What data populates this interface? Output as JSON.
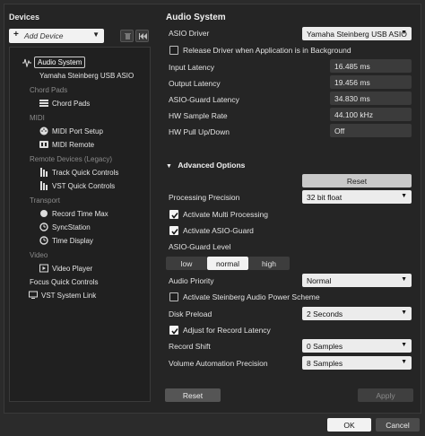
{
  "left": {
    "title": "Devices",
    "add_device": "Add Device",
    "tree": {
      "audio_system": "Audio System",
      "asio_driver_item": "Yamaha Steinberg USB ASIO",
      "cat_chord_pads": "Chord Pads",
      "chord_pads": "Chord Pads",
      "cat_midi": "MIDI",
      "midi_port_setup": "MIDI Port Setup",
      "midi_remote": "MIDI Remote",
      "cat_remote": "Remote Devices (Legacy)",
      "track_quick_controls": "Track Quick Controls",
      "vst_quick_controls": "VST Quick Controls",
      "cat_transport": "Transport",
      "record_time_max": "Record Time Max",
      "syncstation": "SyncStation",
      "time_display": "Time Display",
      "cat_video": "Video",
      "video_player": "Video Player",
      "focus_quick_controls": "Focus Quick Controls",
      "vst_system_link": "VST System Link"
    }
  },
  "right": {
    "title": "Audio System",
    "asio_driver_label": "ASIO Driver",
    "asio_driver_value": "Yamaha Steinberg USB ASIO",
    "release_driver_label": "Release Driver when Application is in Background",
    "release_driver_checked": false,
    "input_latency_label": "Input Latency",
    "input_latency_value": "16.485 ms",
    "output_latency_label": "Output Latency",
    "output_latency_value": "19.456 ms",
    "asio_guard_latency_label": "ASIO-Guard Latency",
    "asio_guard_latency_value": "34.830 ms",
    "hw_sample_rate_label": "HW Sample Rate",
    "hw_sample_rate_value": "44.100 kHz",
    "hw_pull_label": "HW Pull Up/Down",
    "hw_pull_value": "Off",
    "advanced_title": "Advanced Options",
    "reset_inner": "Reset",
    "processing_precision_label": "Processing Precision",
    "processing_precision_value": "32 bit float",
    "activate_multi_label": "Activate Multi Processing",
    "activate_multi_checked": true,
    "activate_asio_guard_label": "Activate ASIO-Guard",
    "activate_asio_guard_checked": true,
    "asio_guard_level_label": "ASIO-Guard Level",
    "level_low": "low",
    "level_normal": "normal",
    "level_high": "high",
    "level_selected": "normal",
    "audio_priority_label": "Audio Priority",
    "audio_priority_value": "Normal",
    "activate_power_label": "Activate Steinberg Audio Power Scheme",
    "activate_power_checked": false,
    "disk_preload_label": "Disk Preload",
    "disk_preload_value": "2 Seconds",
    "adjust_record_label": "Adjust for Record Latency",
    "adjust_record_checked": true,
    "record_shift_label": "Record Shift",
    "record_shift_value": "0 Samples",
    "volume_precision_label": "Volume Automation Precision",
    "volume_precision_value": "8 Samples",
    "reset_button": "Reset",
    "apply_button": "Apply"
  },
  "footer": {
    "ok": "OK",
    "cancel": "Cancel"
  },
  "colors": {
    "background": "#252525",
    "field_dark": "#3b3b3b",
    "dropdown_light": "#ececec",
    "accent_ok": "#f2f2f2"
  }
}
